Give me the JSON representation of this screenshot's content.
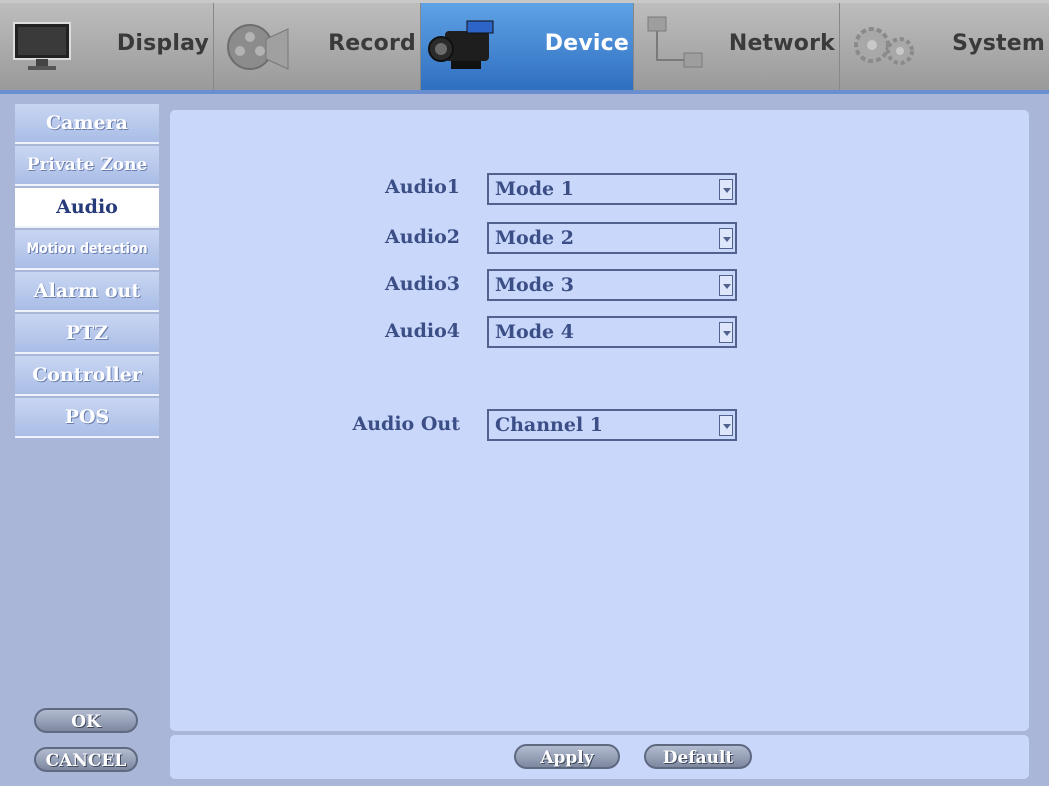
{
  "tabs": [
    {
      "label": "Display",
      "icon": "monitor-icon",
      "active": false
    },
    {
      "label": "Record",
      "icon": "film-reel-icon",
      "active": false
    },
    {
      "label": "Device",
      "icon": "camcorder-icon",
      "active": true
    },
    {
      "label": "Network",
      "icon": "network-icon",
      "active": false
    },
    {
      "label": "System",
      "icon": "gears-icon",
      "active": false
    }
  ],
  "sidebar": {
    "items": [
      {
        "label": "Camera"
      },
      {
        "label": "Private Zone"
      },
      {
        "label": "Audio"
      },
      {
        "label": "Motion detection"
      },
      {
        "label": "Alarm out"
      },
      {
        "label": "PTZ"
      },
      {
        "label": "Controller"
      },
      {
        "label": "POS"
      }
    ],
    "ok_label": "OK",
    "cancel_label": "CANCEL"
  },
  "audio": {
    "rows": [
      {
        "label": "Audio1",
        "value": "Mode 1"
      },
      {
        "label": "Audio2",
        "value": "Mode 2"
      },
      {
        "label": "Audio3",
        "value": "Mode 3"
      },
      {
        "label": "Audio4",
        "value": "Mode 4"
      }
    ],
    "out_label": "Audio Out",
    "out_value": "Channel 1"
  },
  "footer": {
    "apply_label": "Apply",
    "default_label": "Default"
  },
  "colors": {
    "active_tab": "#3f85d6",
    "panel": "#c9d7fb",
    "text": "#3b4e86"
  }
}
